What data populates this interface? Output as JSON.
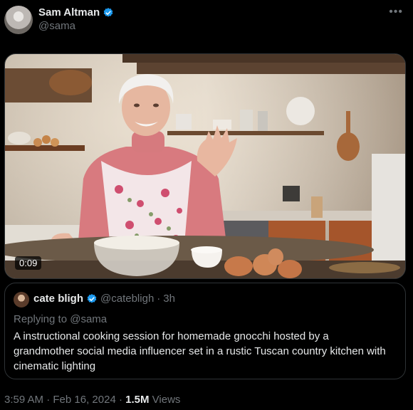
{
  "author": {
    "name": "Sam Altman",
    "handle": "@sama"
  },
  "more_icon": "more-horizontal-icon",
  "media": {
    "duration": "0:09"
  },
  "quote": {
    "name": "cate bligh",
    "handle": "@catebligh",
    "separator": "·",
    "age": "3h",
    "replying_prefix": "Replying to",
    "replying_handle": "@sama",
    "text": "A instructional cooking session for homemade gnocchi hosted by a grandmother social media influencer set in a rustic Tuscan country kitchen with cinematic lighting"
  },
  "footer": {
    "time": "3:59 AM",
    "date": "Feb 16, 2024",
    "separator": "·",
    "views_count": "1.5M",
    "views_label": "Views"
  },
  "colors": {
    "background": "#000000",
    "text_primary": "#e7e9ea",
    "text_secondary": "#71767b",
    "border": "#2f3336",
    "verified": "#1d9bf0"
  }
}
